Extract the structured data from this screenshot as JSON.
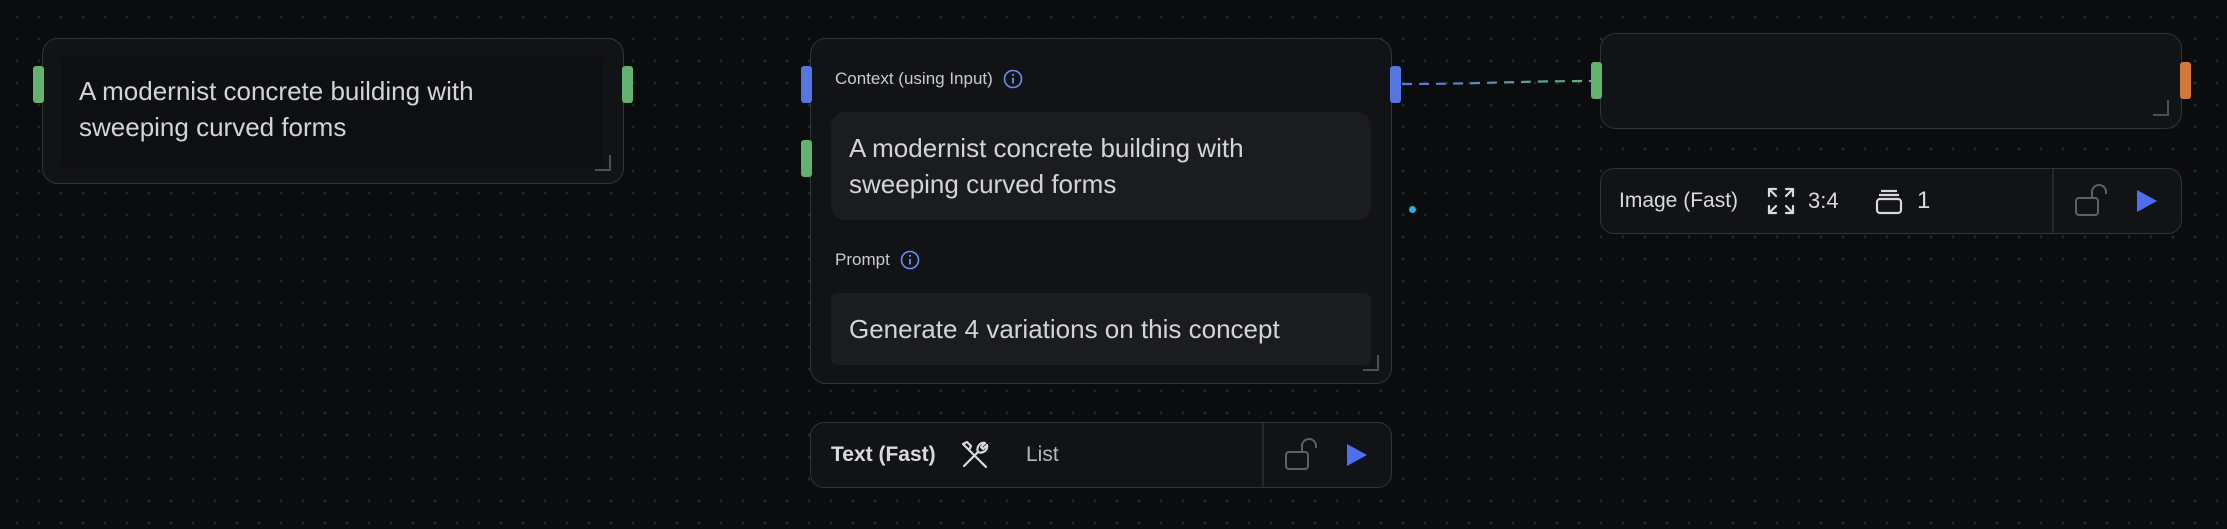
{
  "colors": {
    "background": "#0b0c0e",
    "node_bg": "#121316",
    "node_border": "#303338",
    "text_area_bg": "#1b1c20",
    "handle_text": "#63b36e",
    "handle_context": "#5576e0",
    "handle_image": "#d27838",
    "run_button": "#4f6ef0",
    "connection_dot": "#1fb6d3"
  },
  "input_node": {
    "text": "A modernist concrete building with sweeping curved forms"
  },
  "text_node": {
    "context_label": "Context (using Input)",
    "context_value": "A modernist concrete building with sweeping curved forms",
    "prompt_label": "Prompt",
    "prompt_value": "Generate 4 variations on this concept",
    "toolbar": {
      "model": "Text (Fast)",
      "tools_icon": "wrench-screwdriver-icon",
      "mode": "List",
      "lock_icon": "unlock-icon",
      "run_icon": "play-icon"
    }
  },
  "image_node": {
    "output": "",
    "toolbar": {
      "model": "Image (Fast)",
      "aspect_icon": "expand-icon",
      "aspect_ratio": "3:4",
      "count_icon": "stack-icon",
      "count": "1",
      "lock_icon": "unlock-icon",
      "run_icon": "play-icon"
    }
  }
}
